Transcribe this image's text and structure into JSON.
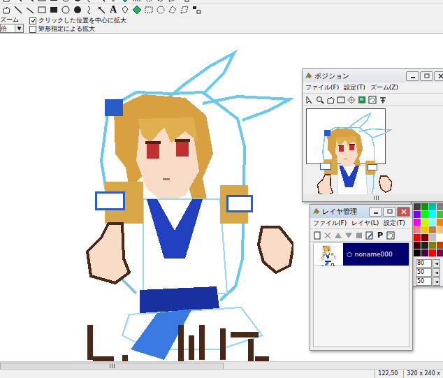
{
  "toolbar": {
    "text_tool": "A"
  },
  "zoom": {
    "label": "ズーム",
    "value": "倍",
    "arrow": "▼"
  },
  "options": [
    {
      "label": "クリックした位置を中心に拡大",
      "checked": true
    },
    {
      "label": "矩形指定による拡大",
      "checked": false
    }
  ],
  "status_bar": [
    "122,50",
    "320 x 240 x"
  ],
  "position_window": {
    "title": "ポジション",
    "menu": [
      "ファイル(F)",
      "設定(T)",
      "ズーム(Z)"
    ]
  },
  "layer_window": {
    "title": "レイヤ管理",
    "menu": [
      "ファイル(F)",
      "レイヤ(L)",
      "設定(T)"
    ],
    "toolbar_text": "P",
    "layers": [
      {
        "mark": "○",
        "name": "noname000",
        "selected": true
      }
    ]
  },
  "palette": {
    "swatches": [
      {
        "color": "#404040"
      },
      {
        "color": "#00a000"
      },
      {
        "color": "#00c0c0"
      },
      {
        "color": "#808080"
      },
      {
        "color": "#8000ff"
      },
      {
        "color": "#00ff00"
      },
      {
        "color": "#00ffff"
      },
      {
        "color": "#40c040"
      },
      {
        "color": "#ff00ff"
      },
      {
        "color": "#c0ff00"
      },
      {
        "color": "#80ffff"
      },
      {
        "color": "#ff8000"
      },
      {
        "color": "#ff8080"
      },
      {
        "color": "#ffc000"
      },
      {
        "color": "#c08040"
      },
      {
        "color": "#ffc080"
      },
      {
        "color": "#ff0000"
      },
      {
        "color": "#800000"
      },
      {
        "color": "#c0c0c0"
      },
      {
        "color": "#ffffff"
      },
      {
        "color": "#400000"
      },
      {
        "color": "#202020"
      },
      {
        "color": "#808000"
      },
      {
        "color": "#c04000"
      },
      {
        "color": "#000000"
      },
      {
        "color": "#400040"
      },
      {
        "color": "#ff0000"
      },
      {
        "color": "#800040"
      }
    ],
    "values": [
      "80",
      "50",
      "50"
    ],
    "arrow": "◄"
  }
}
